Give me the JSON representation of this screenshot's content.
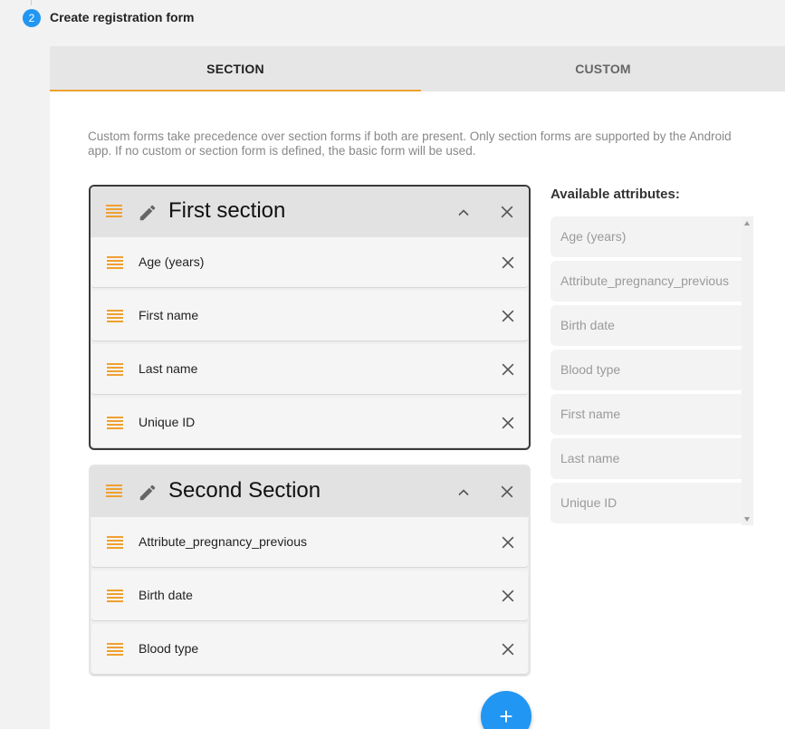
{
  "step": {
    "number": "2",
    "title": "Create registration form"
  },
  "tabs": [
    {
      "label": "SECTION",
      "active": true
    },
    {
      "label": "CUSTOM",
      "active": false
    }
  ],
  "description": "Custom forms take precedence over section forms if both are present. Only section forms are supported by the Android app. If no custom or section form is defined, the basic form will be used.",
  "sections": [
    {
      "title": "First section",
      "fields": [
        "Age (years)",
        "First name",
        "Last name",
        "Unique ID"
      ]
    },
    {
      "title": "Second Section",
      "fields": [
        "Attribute_pregnancy_previous",
        "Birth date",
        "Blood type"
      ]
    }
  ],
  "available": {
    "title": "Available attributes:",
    "items": [
      "Age (years)",
      "Attribute_pregnancy_previous",
      "Birth date",
      "Blood type",
      "First name",
      "Last name",
      "Unique ID"
    ]
  },
  "fab": {
    "label": "+"
  },
  "colors": {
    "accent": "#2196f3",
    "drag": "#f0a030"
  }
}
